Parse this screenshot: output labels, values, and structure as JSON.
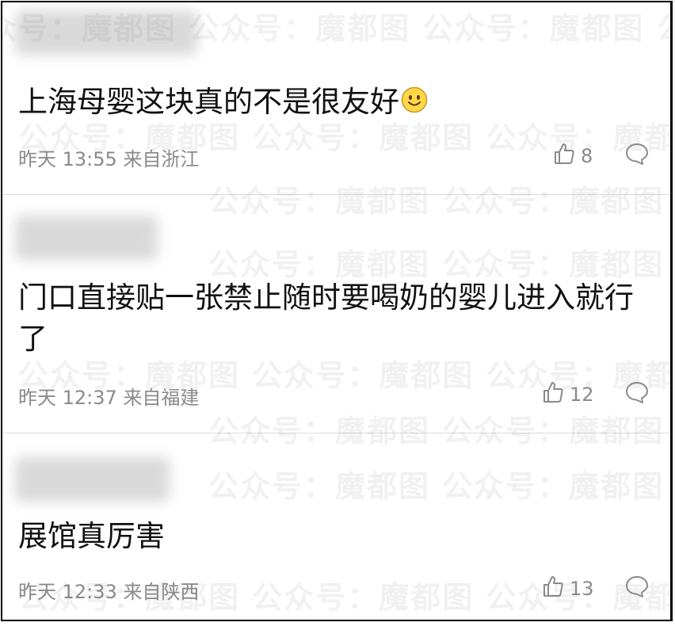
{
  "watermark_text": "公众号：魔都图",
  "comments": [
    {
      "text": "上海母婴这块真的不是很友好",
      "emoji": "smiley-face",
      "time": "昨天 13:55",
      "location": "来自浙江",
      "likes": "8"
    },
    {
      "text": "门口直接贴一张禁止随时要喝奶的婴儿进入就行了",
      "time": "昨天 12:37",
      "location": "来自福建",
      "likes": "12"
    },
    {
      "text": "展馆真厉害",
      "time": "昨天 12:33",
      "location": "来自陕西",
      "likes": "13"
    }
  ]
}
